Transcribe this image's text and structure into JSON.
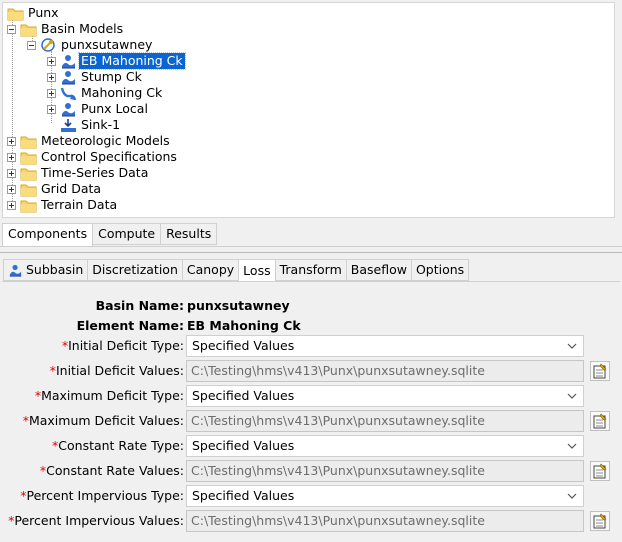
{
  "tree": {
    "root": "Punx",
    "basin_models": "Basin Models",
    "basin": "punxsutawney",
    "elements": [
      {
        "label": "EB Mahoning Ck",
        "selected": true,
        "icon": "subbasin-icon"
      },
      {
        "label": "Stump Ck",
        "selected": false,
        "icon": "subbasin-icon"
      },
      {
        "label": "Mahoning Ck",
        "selected": false,
        "icon": "reach-icon"
      },
      {
        "label": "Punx Local",
        "selected": false,
        "icon": "subbasin-icon"
      },
      {
        "label": "Sink-1",
        "selected": false,
        "icon": "sink-icon"
      }
    ],
    "folders": [
      "Meteorologic Models",
      "Control Specifications",
      "Time-Series Data",
      "Grid Data",
      "Terrain Data"
    ]
  },
  "main_tabs": [
    "Components",
    "Compute",
    "Results"
  ],
  "prop_tabs": [
    "Subbasin",
    "Discretization",
    "Canopy",
    "Loss",
    "Transform",
    "Baseflow",
    "Options"
  ],
  "form": {
    "basin_name_label": "Basin Name:",
    "basin_name": "punxsutawney",
    "element_name_label": "Element Name:",
    "element_name": "EB Mahoning Ck",
    "required_mark": "*",
    "initial_deficit_type_label": "Initial Deficit Type:",
    "initial_deficit_type": "Specified Values",
    "initial_deficit_values_label": "Initial Deficit Values:",
    "initial_deficit_values": "C:\\Testing\\hms\\v413\\Punx\\punxsutawney.sqlite",
    "maximum_deficit_type_label": "Maximum Deficit Type:",
    "maximum_deficit_type": "Specified Values",
    "maximum_deficit_values_label": "Maximum Deficit Values:",
    "maximum_deficit_values": "C:\\Testing\\hms\\v413\\Punx\\punxsutawney.sqlite",
    "constant_rate_type_label": "Constant Rate Type:",
    "constant_rate_type": "Specified Values",
    "constant_rate_values_label": "Constant Rate Values:",
    "constant_rate_values": "C:\\Testing\\hms\\v413\\Punx\\punxsutawney.sqlite",
    "percent_impervious_type_label": "Percent Impervious Type:",
    "percent_impervious_type": "Specified Values",
    "percent_impervious_values_label": "Percent Impervious Values:",
    "percent_impervious_values": "C:\\Testing\\hms\\v413\\Punx\\punxsutawney.sqlite"
  },
  "colors": {
    "selection": "#0a64d2",
    "required": "#e00000",
    "folder": "#f2c94c"
  }
}
